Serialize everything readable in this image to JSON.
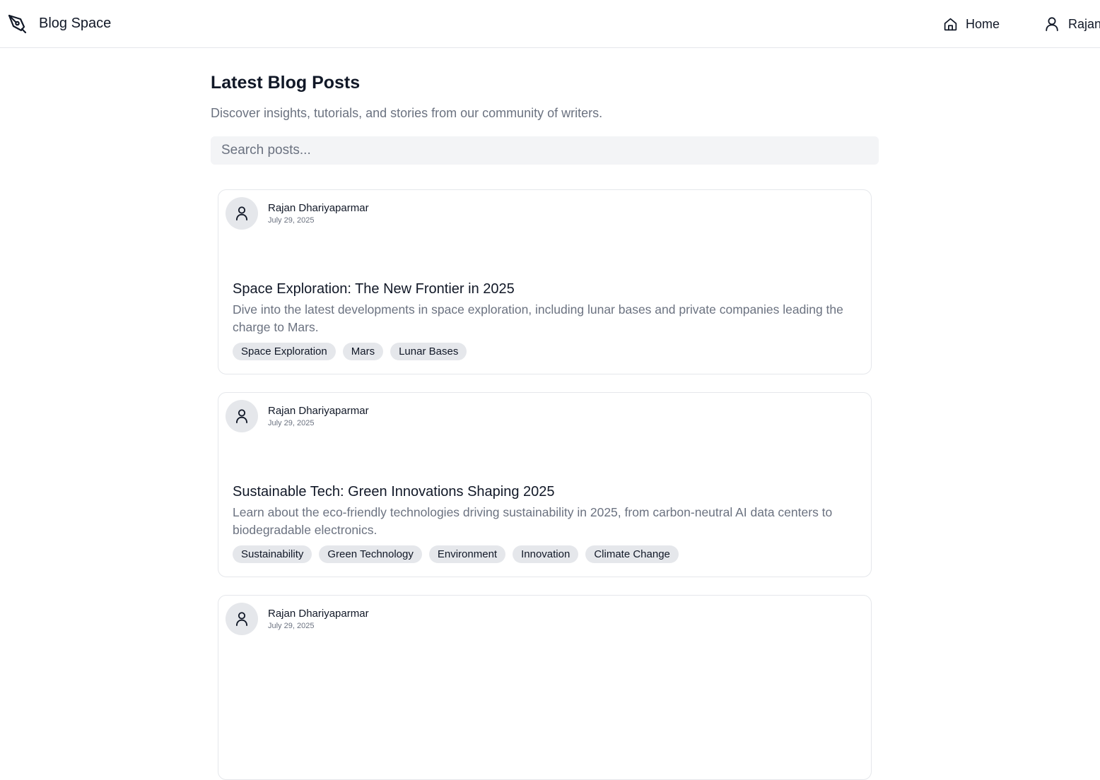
{
  "header": {
    "brand_name": "Blog Space",
    "nav": {
      "home_label": "Home",
      "user_label": "Rajan"
    }
  },
  "main": {
    "title": "Latest Blog Posts",
    "subtitle": "Discover insights, tutorials, and stories from our community of writers.",
    "search": {
      "placeholder": "Search posts...",
      "value": ""
    }
  },
  "posts": [
    {
      "author": "Rajan Dhariyaparmar",
      "date": "July 29, 2025",
      "title": "Space Exploration: The New Frontier in 2025",
      "excerpt": "Dive into the latest developments in space exploration, including lunar bases and private companies leading the charge to Mars.",
      "tags": [
        "Space Exploration",
        "Mars",
        "Lunar Bases"
      ]
    },
    {
      "author": "Rajan Dhariyaparmar",
      "date": "July 29, 2025",
      "title": "Sustainable Tech: Green Innovations Shaping 2025",
      "excerpt": "Learn about the eco-friendly technologies driving sustainability in 2025, from carbon-neutral AI data centers to biodegradable electronics.",
      "tags": [
        "Sustainability",
        "Green Technology",
        "Environment",
        "Innovation",
        "Climate Change"
      ]
    },
    {
      "author": "Rajan Dhariyaparmar",
      "date": "July 29, 2025"
    }
  ],
  "icons": {
    "brand": "pen-nib-icon",
    "home": "home-icon",
    "user": "user-icon",
    "avatar": "user-avatar-icon"
  },
  "colors": {
    "text": "#111827",
    "muted": "#6b7280",
    "border": "#e5e7eb",
    "search_bg": "#f3f4f6",
    "tag_bg": "#e5e7eb"
  }
}
